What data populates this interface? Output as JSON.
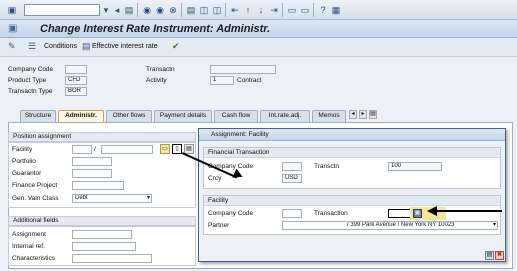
{
  "toolbar": {
    "command_value": ""
  },
  "window": {
    "title": "Change Interest Rate Instrument: Administr."
  },
  "app_toolbar": {
    "conditions": "Conditions",
    "effective_interest_rate": "Effective interest rate"
  },
  "header": {
    "company_code_label": "Company Code",
    "company_code_value": "",
    "product_type_label": "Product Type",
    "product_type_value": "CFD",
    "transactn_type_label": "Transactn Type",
    "transactn_type_value": "BOR",
    "transactn_label": "Transactn",
    "transactn_value": "",
    "activity_label": "Activity",
    "activity_value": "1",
    "activity_text": "Contract"
  },
  "tabs": [
    "Structure",
    "Administr.",
    "Other flows",
    "Payment details",
    "Cash flow",
    "Int.rate.adj.",
    "Memos"
  ],
  "position_assignment": {
    "title": "Position assignment",
    "facility_label": "Facility",
    "facility_sep": "/",
    "portfolio_label": "Portfolio",
    "guarantor_label": "Guarantor",
    "finance_project_label": "Finance Project",
    "gen_valn_class_label": "Gen. Valn Class",
    "gen_valn_class_value": "Debt"
  },
  "additional_fields": {
    "title": "Additional fields",
    "assignment_label": "Assignment",
    "internal_ref_label": "Internal ref.",
    "characteristics_label": "Characteristics"
  },
  "dialog": {
    "title": "Assignment: Facility",
    "financial_transaction": {
      "title": "Financial Transaction",
      "company_code_label": "Company Code",
      "company_code_value": "",
      "transctn_label": "Transctn",
      "transctn_value": "100",
      "crcy_label": "Crcy",
      "crcy_value": "USD"
    },
    "facility": {
      "title": "Facility",
      "company_code_label": "Company Code",
      "company_code_value": "",
      "transaction_label": "Transaction",
      "transaction_value": "",
      "partner_label": "Partner",
      "partner_value": "/ 399 Park Avenue / New York NY 10023"
    }
  }
}
